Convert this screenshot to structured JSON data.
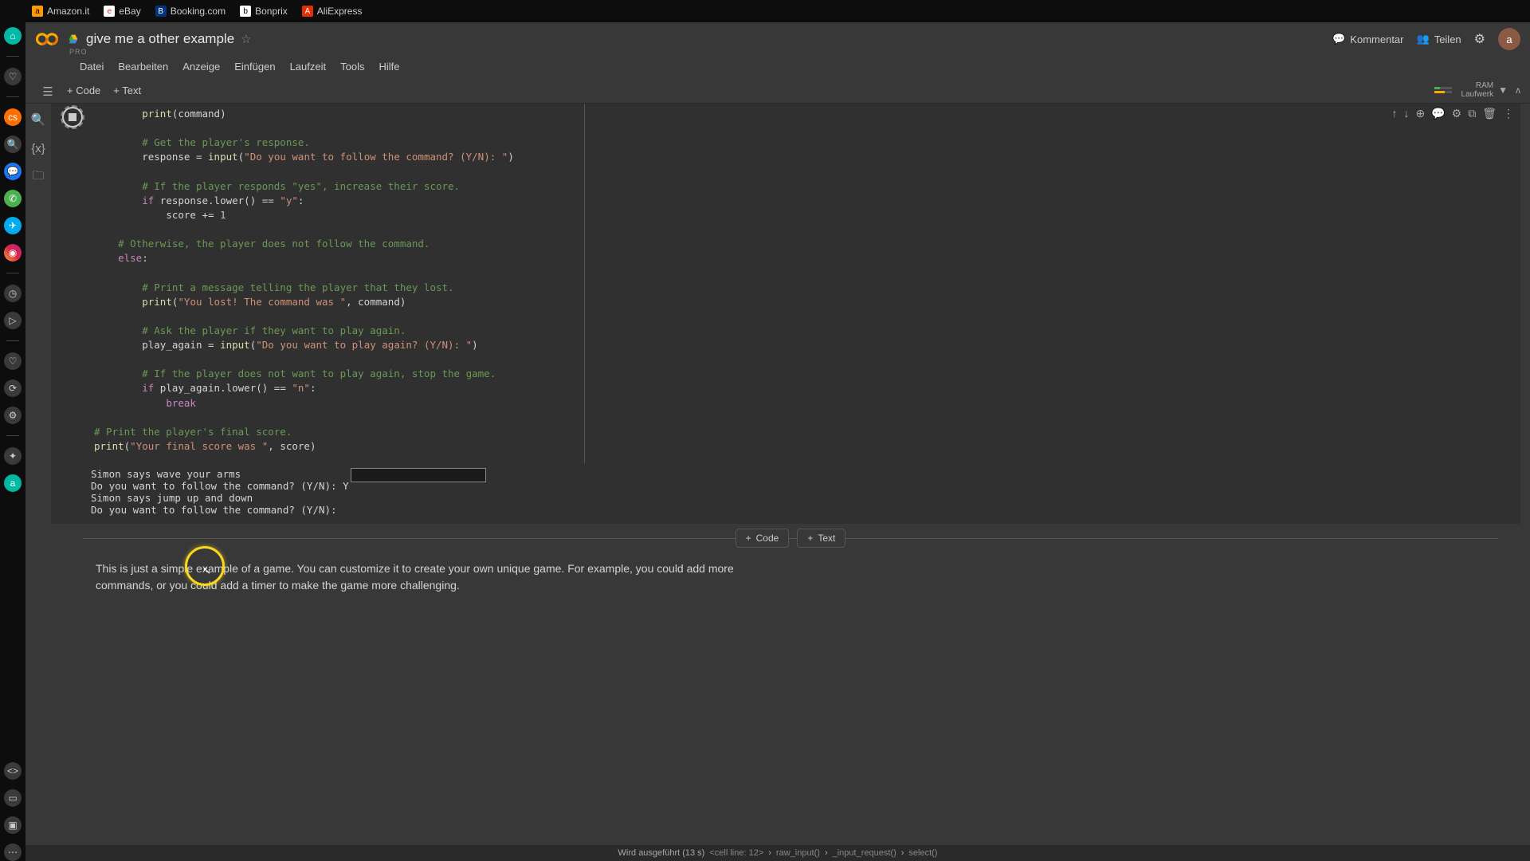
{
  "browser": {
    "tabs": [
      {
        "label": "Amazon.it",
        "icon": "a",
        "bg": "#ff9900"
      },
      {
        "label": "eBay",
        "icon": "e",
        "bg": "#e53238"
      },
      {
        "label": "Booking.com",
        "icon": "B",
        "bg": "#003580"
      },
      {
        "label": "Bonprix",
        "icon": "b",
        "bg": "#000"
      },
      {
        "label": "AliExpress",
        "icon": "A",
        "bg": "#e62e04"
      }
    ]
  },
  "header": {
    "doc_title": "give me a other example",
    "pro": "PRO",
    "kommentar": "Kommentar",
    "teilen": "Teilen",
    "avatar": "a"
  },
  "menubar": [
    "Datei",
    "Bearbeiten",
    "Anzeige",
    "Einfügen",
    "Laufzeit",
    "Tools",
    "Hilfe"
  ],
  "toolbar": {
    "add_code": "+ Code",
    "add_text": "+ Text",
    "ram": "RAM",
    "laufwerk": "Laufwerk"
  },
  "code": {
    "l1": "print",
    "l1b": "(command)",
    "c1": "# Get the player's response.",
    "l2a": "response = ",
    "l2b": "input",
    "l2c": "(",
    "l2d": "\"Do you want to follow the command? (Y/N): \"",
    "l2e": ")",
    "c2": "# If the player responds \"yes\", increase their score.",
    "l3a": "if",
    "l3b": " response.lower() == ",
    "l3c": "\"y\"",
    "l3d": ":",
    "l4a": "score += ",
    "l4b": "1",
    "c3": "# Otherwise, the player does not follow the command.",
    "l5a": "else",
    "l5b": ":",
    "c4": "# Print a message telling the player that they lost.",
    "l6a": "print",
    "l6b": "(",
    "l6c": "\"You lost! The command was \"",
    "l6d": ", command)",
    "c5": "# Ask the player if they want to play again.",
    "l7a": "play_again = ",
    "l7b": "input",
    "l7c": "(",
    "l7d": "\"Do you want to play again? (Y/N): \"",
    "l7e": ")",
    "c6": "# If the player does not want to play again, stop the game.",
    "l8a": "if",
    "l8b": " play_again.lower() == ",
    "l8c": "\"n\"",
    "l8d": ":",
    "l9": "break",
    "c7": "# Print the player's final score.",
    "l10a": "print",
    "l10b": "(",
    "l10c": "\"Your final score was \"",
    "l10d": ", score)"
  },
  "output": {
    "line1": "Simon says wave your arms",
    "line2": "Do you want to follow the command? (Y/N): Y",
    "line3": "Simon says jump up and down",
    "line4": "Do you want to follow the command? (Y/N): "
  },
  "insert": {
    "code": "Code",
    "text": "Text"
  },
  "textcell": "This is just a simple example of a game. You can customize it to create your own unique game. For example, you could add more commands, or you could add a timer to make the game more challenging.",
  "status": {
    "prefix": "Wird ausgeführt (13 s)",
    "p1": "<cell line: 12>",
    "p2": "raw_input()",
    "p3": "_input_request()",
    "p4": "select()"
  }
}
